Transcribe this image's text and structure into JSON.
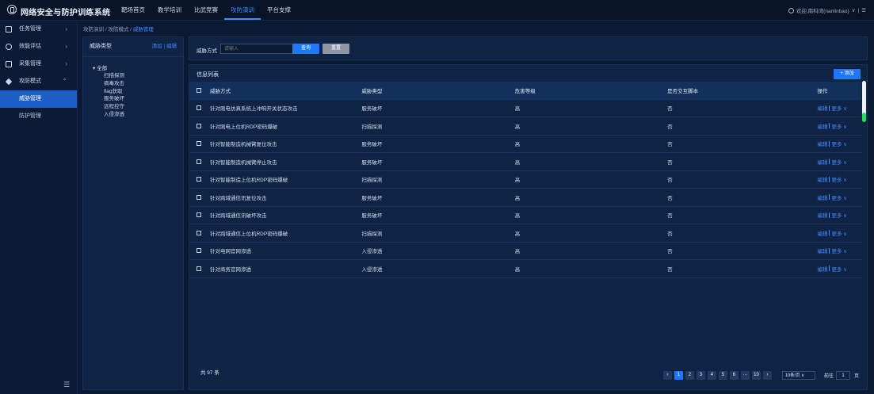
{
  "app": {
    "title": "网络安全与防护训练系统",
    "nav": [
      "靶场首页",
      "教学培训",
      "比武竞赛",
      "攻防演训",
      "平台支撑"
    ],
    "active_nav": "攻防演训",
    "user": "欢迎,南科湾(nanlinbao)",
    "user_arrow": "∨",
    "user_sep": "|",
    "user_menu": "☰"
  },
  "sidebar": {
    "items": [
      {
        "label": "任务管理",
        "arrow": "›"
      },
      {
        "label": "效能评估",
        "arrow": "›"
      },
      {
        "label": "采集管理",
        "arrow": "›"
      },
      {
        "label": "攻防模式",
        "arrow": "⌃"
      }
    ],
    "subitems": [
      "威胁管理",
      "防护管理"
    ],
    "collapse": "☰"
  },
  "breadcrumb": {
    "a": "攻防演训",
    "sep1": "/",
    "b": "攻防模式",
    "sep2": "/",
    "c": "威胁管理"
  },
  "tree": {
    "header": "威胁类型",
    "add": "添加",
    "sep": "|",
    "edit": "编辑",
    "root": "全部",
    "children": [
      "扫描探测",
      "病毒攻击",
      "flag获取",
      "服务破坏",
      "远程控守",
      "入侵渗透"
    ]
  },
  "search": {
    "label": "威胁方式",
    "placeholder": "请输入",
    "query": "查询",
    "reset": "重置"
  },
  "list": {
    "title": "信息列表",
    "add": "+ 添加",
    "headers": [
      "威胁方式",
      "威胁类型",
      "危害等级",
      "是否交互脚本",
      "操作"
    ],
    "rows": [
      [
        "针对刚电仿真系统上冲响开关状态攻击",
        "服务破坏",
        "高",
        "否"
      ],
      [
        "针对刚电上位机RDP密码爆破",
        "扫描探测",
        "高",
        "否"
      ],
      [
        "针对智能制造机械臂复位攻击",
        "服务破坏",
        "高",
        "否"
      ],
      [
        "针对智能制造机械臂停止攻击",
        "服务破坏",
        "高",
        "否"
      ],
      [
        "针对智能制造上位机RDP密码爆破",
        "扫描探测",
        "高",
        "否"
      ],
      [
        "针对跨域通信讯复位攻击",
        "服务破坏",
        "高",
        "否"
      ],
      [
        "针对跨域通信讯破坏攻击",
        "服务破坏",
        "高",
        "否"
      ],
      [
        "针对跨域通信上位机RDP密码爆破",
        "扫描探测",
        "高",
        "否"
      ],
      [
        "针对电网官网渗透",
        "入侵渗透",
        "高",
        "否"
      ],
      [
        "针对商务官网渗透",
        "入侵渗透",
        "高",
        "否"
      ]
    ],
    "op_edit": "编辑",
    "op_more": "更多 ∨"
  },
  "pagination": {
    "total": "共 97 条",
    "prev": "‹",
    "pages": [
      "1",
      "2",
      "3",
      "4",
      "5",
      "6",
      "···",
      "10"
    ],
    "next": "›",
    "page_size": "10条/页  ∨",
    "goto_label": "前往",
    "goto_value": "1",
    "goto_unit": "页"
  },
  "colors": {
    "accent": "#1e78ff",
    "background": "#0a1a33",
    "panel": "#0f2445"
  }
}
